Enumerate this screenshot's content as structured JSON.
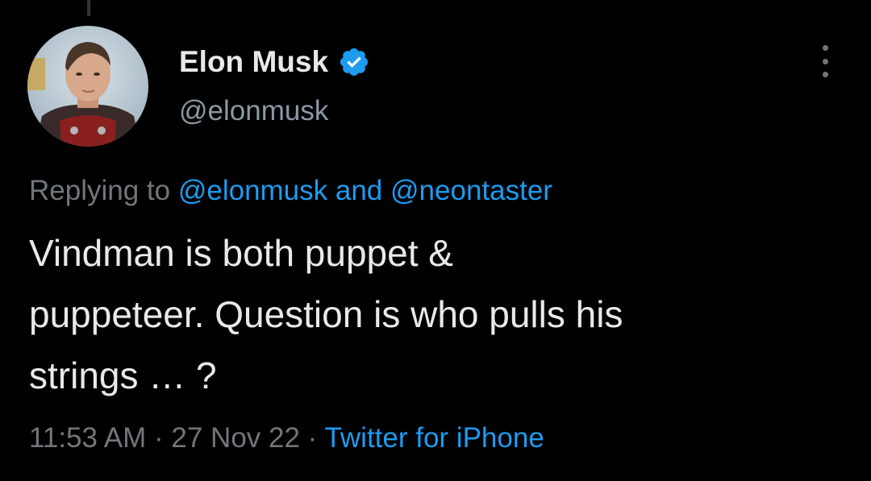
{
  "author": {
    "display_name": "Elon Musk",
    "handle": "@elonmusk",
    "avatar_icon": "profile-photo",
    "verified_icon": "verified-badge-icon"
  },
  "reply": {
    "prefix": "Replying to ",
    "mention_1": "@elonmusk",
    "conjunction": " and ",
    "mention_2": "@neontaster"
  },
  "tweet": {
    "text": "Vindman is both puppet &\npuppeteer. Question is who pulls his\nstrings … ?"
  },
  "meta": {
    "time": "11:53 AM",
    "separator_1": " · ",
    "date": "27 Nov 22",
    "separator_2": " · ",
    "source": "Twitter for iPhone"
  },
  "colors": {
    "background": "#000000",
    "text_primary": "#e7e9ea",
    "text_secondary": "#71767b",
    "accent": "#1d9bf0"
  }
}
